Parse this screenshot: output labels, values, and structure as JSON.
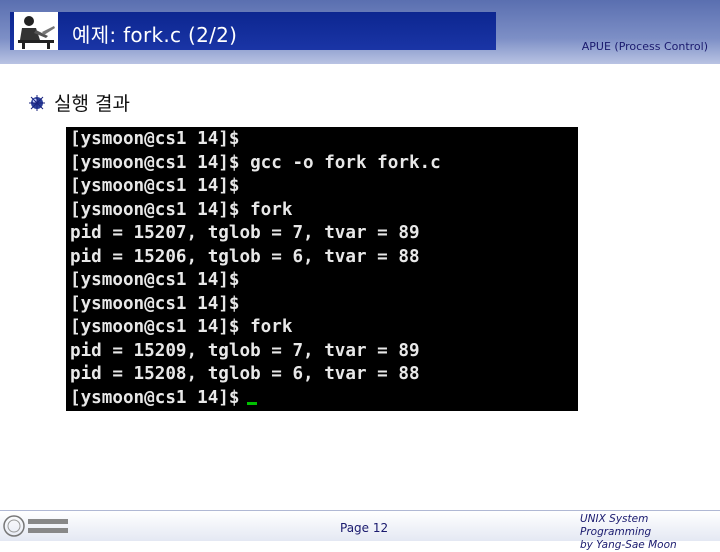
{
  "slide": {
    "title": "예제: fork.c (2/2)",
    "course_tag": "APUE (Process Control)",
    "bullet": "실행 결과"
  },
  "terminal": {
    "lines": [
      "[ysmoon@cs1 14]$",
      "[ysmoon@cs1 14]$ gcc -o fork fork.c",
      "[ysmoon@cs1 14]$",
      "[ysmoon@cs1 14]$ fork",
      "pid = 15207, tglob = 7, tvar = 89",
      "pid = 15206, tglob = 6, tvar = 88",
      "[ysmoon@cs1 14]$",
      "[ysmoon@cs1 14]$",
      "[ysmoon@cs1 14]$ fork",
      "pid = 15209, tglob = 7, tvar = 89",
      "pid = 15208, tglob = 6, tvar = 88",
      "[ysmoon@cs1 14]$"
    ],
    "cursor_color": "#00c000"
  },
  "footer": {
    "page": "Page 12",
    "credit_line1": "UNIX System Programming",
    "credit_line2": "by Yang-Sae Moon"
  },
  "colors": {
    "title_bar": "#0c2690",
    "text_accent": "#1a1a6e"
  },
  "icons": {
    "header": "person-at-desk-icon",
    "bullet": "orb-bullet-icon",
    "footer": "university-logo-icon"
  }
}
